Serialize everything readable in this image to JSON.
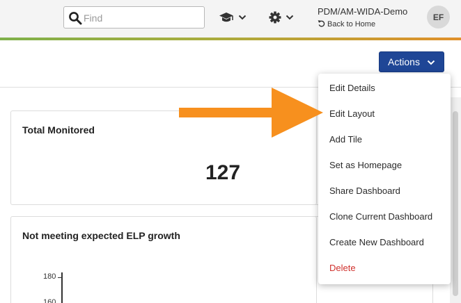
{
  "header": {
    "search": {
      "placeholder": "Find",
      "value": "",
      "icon": "search-icon"
    },
    "courses_icon": "graduation-cap-icon",
    "settings_icon": "gear-icon",
    "account": {
      "org_name": "PDM/AM-WIDA-Demo",
      "back_home": "Back to Home",
      "back_home_icon": "undo-icon"
    },
    "avatar_initials": "EF",
    "stripe_colors": [
      "#7fb04a",
      "#a9ad3e",
      "#e0902a"
    ]
  },
  "toolbar": {
    "actions_label": "Actions",
    "actions_color": "#1f4696"
  },
  "tiles": [
    {
      "title": "Total Monitored",
      "value": "127"
    },
    {
      "title": "Not meeting expected ELP growth",
      "y_ticks": [
        "180",
        "160"
      ]
    }
  ],
  "actions_menu": {
    "items": [
      {
        "label": "Edit Details"
      },
      {
        "label": "Edit Layout"
      },
      {
        "label": "Add Tile"
      },
      {
        "label": "Set as Homepage"
      },
      {
        "label": "Share Dashboard"
      },
      {
        "label": "Clone Current Dashboard"
      },
      {
        "label": "Create New Dashboard"
      },
      {
        "label": "Delete",
        "color": "#d0312d"
      }
    ]
  },
  "annotation": {
    "arrow_color": "#f7901e",
    "points_to": "Edit Layout"
  }
}
